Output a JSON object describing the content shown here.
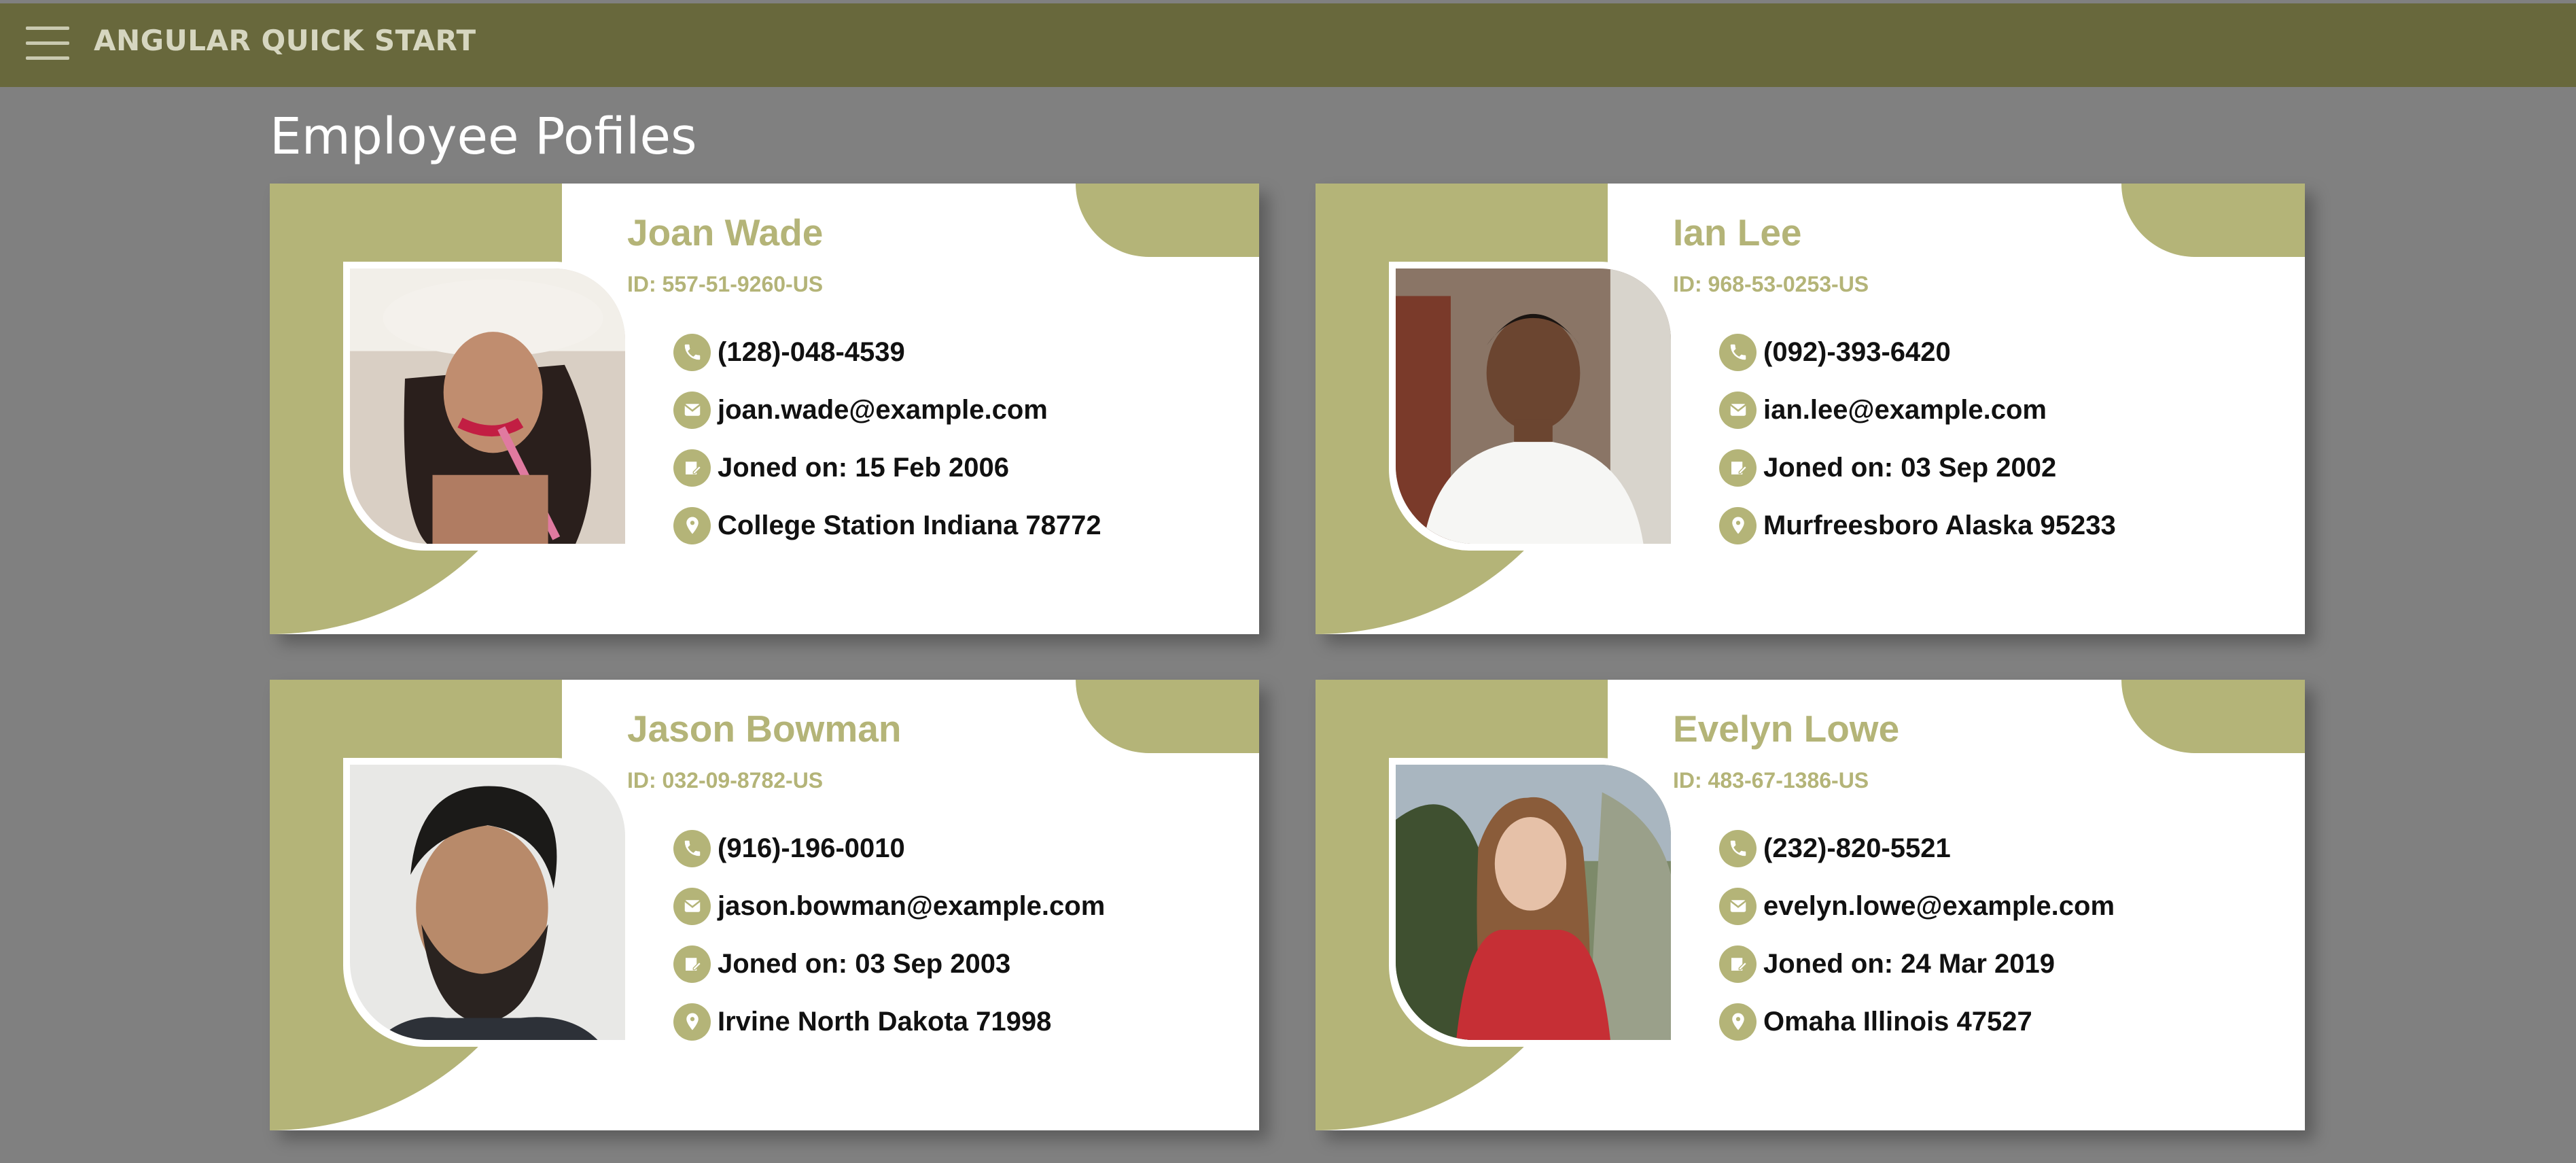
{
  "header": {
    "title": "ANGULAR QUICK START"
  },
  "page": {
    "title": "Employee Pofiles"
  },
  "colors": {
    "accent": "#b4b478",
    "toolbar": "#68683c",
    "background": "#808080"
  },
  "icons": {
    "phone": "phone-icon",
    "email": "envelope-icon",
    "joined": "calendar-edit-icon",
    "address": "location-pin-icon"
  },
  "employees": [
    {
      "name": "Joan Wade",
      "id": "ID: 557-51-9260-US",
      "phone": "(128)-048-4539",
      "email": "joan.wade@example.com",
      "joined": "Joned on: 15 Feb 2006",
      "address": "College Station Indiana 78772"
    },
    {
      "name": "Ian Lee",
      "id": "ID: 968-53-0253-US",
      "phone": "(092)-393-6420",
      "email": "ian.lee@example.com",
      "joined": "Joned on: 03 Sep 2002",
      "address": "Murfreesboro Alaska 95233"
    },
    {
      "name": "Jason Bowman",
      "id": "ID: 032-09-8782-US",
      "phone": "(916)-196-0010",
      "email": "jason.bowman@example.com",
      "joined": "Joned on: 03 Sep 2003",
      "address": "Irvine North Dakota 71998"
    },
    {
      "name": "Evelyn Lowe",
      "id": "ID: 483-67-1386-US",
      "phone": "(232)-820-5521",
      "email": "evelyn.lowe@example.com",
      "joined": "Joned on: 24 Mar 2019",
      "address": "Omaha Illinois 47527"
    }
  ]
}
